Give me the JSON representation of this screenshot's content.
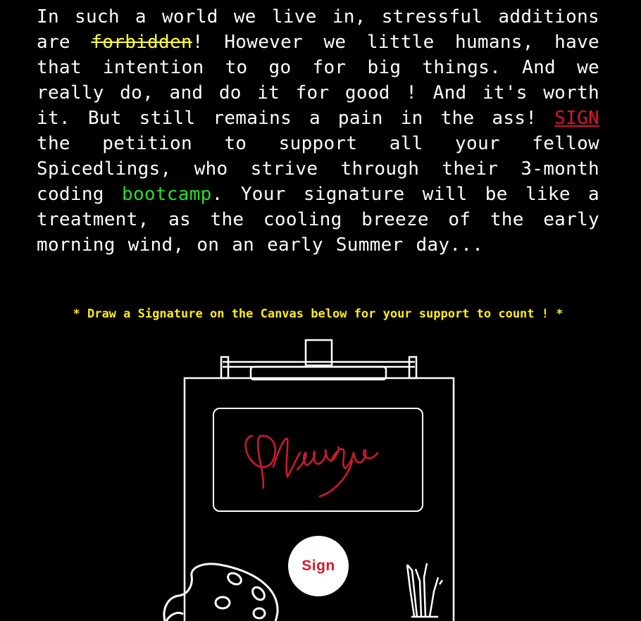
{
  "petition": {
    "part1": "In such a world we live in, stressful additions are ",
    "struck_word": "forbidden",
    "part2": "! However we little humans, have that intention to go for big things. And we really do, and do it for good ! And it's worth it. But still remains a pain in the ass! ",
    "sign_link": "SIGN",
    "part3": " the petition to support all your fellow Spicedlings, who strive through their 3-month coding ",
    "highlight_word": "bootcamp",
    "part4": ". Your signature will be like a treatment, as the cooling breeze of the early morning wind, on an early Summer day..."
  },
  "instruction": "* Draw a Signature on the Canvas below for your support to count ! *",
  "sign_button_label": "Sign",
  "colors": {
    "background": "#000000",
    "text": "#ffffff",
    "struck": "#ffff3c",
    "link": "#e0112e",
    "highlight": "#2bdc2b",
    "instruction": "#ffeb18",
    "signature": "#d11a2f"
  },
  "icons": [
    "paint-palette-icon",
    "brushes-icon",
    "easel-icon"
  ]
}
